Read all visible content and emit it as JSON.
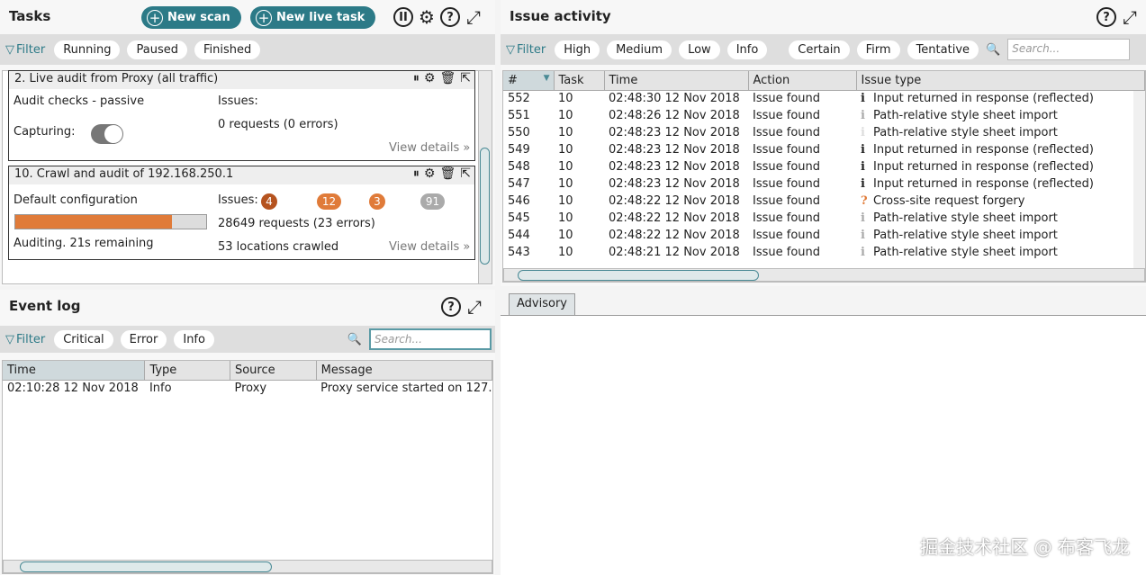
{
  "tasks": {
    "title": "Tasks",
    "new_scan": "New scan",
    "new_live_task": "New live task",
    "filter_label": "Filter",
    "filters": [
      "Running",
      "Paused",
      "Finished"
    ],
    "cards": [
      {
        "title": "2. Live audit from Proxy (all traffic)",
        "config": "Audit checks - passive",
        "issues_label": "Issues:",
        "requests": "0 requests (0 errors)",
        "capturing_label": "Capturing:",
        "capturing_on": true,
        "view_details": "View details"
      },
      {
        "title": "10. Crawl and audit of 192.168.250.1",
        "config": "Default configuration",
        "issues_label": "Issues:",
        "badges": [
          "4",
          "12",
          "3",
          "91"
        ],
        "progress_percent": 82,
        "requests": "28649 requests (23 errors)",
        "status": "Auditing. 21s remaining",
        "locations": "53 locations crawled",
        "view_details": "View details"
      }
    ]
  },
  "event_log": {
    "title": "Event log",
    "filter_label": "Filter",
    "filters": [
      "Critical",
      "Error",
      "Info"
    ],
    "search_placeholder": "Search...",
    "columns": [
      "Time",
      "Type",
      "Source",
      "Message"
    ],
    "rows": [
      [
        "02:10:28 12 Nov 2018",
        "Info",
        "Proxy",
        "Proxy service started on 127."
      ]
    ]
  },
  "issue_activity": {
    "title": "Issue activity",
    "filter_label": "Filter",
    "filters": [
      "High",
      "Medium",
      "Low",
      "Info"
    ],
    "confidence_filters": [
      "Certain",
      "Firm",
      "Tentative"
    ],
    "search_placeholder": "Search...",
    "columns": [
      "#",
      "Task",
      "Time",
      "Action",
      "Issue type"
    ],
    "rows": [
      [
        "552",
        "10",
        "02:48:30 12 Nov 2018",
        "Issue found",
        "Input returned in response (reflected)",
        "i",
        "#222"
      ],
      [
        "551",
        "10",
        "02:48:26 12 Nov 2018",
        "Issue found",
        "Path-relative style sheet import",
        "i",
        "#aaa"
      ],
      [
        "550",
        "10",
        "02:48:23 12 Nov 2018",
        "Issue found",
        "Path-relative style sheet import",
        "i",
        "#ddd"
      ],
      [
        "549",
        "10",
        "02:48:23 12 Nov 2018",
        "Issue found",
        "Input returned in response (reflected)",
        "i",
        "#222"
      ],
      [
        "548",
        "10",
        "02:48:23 12 Nov 2018",
        "Issue found",
        "Input returned in response (reflected)",
        "i",
        "#222"
      ],
      [
        "547",
        "10",
        "02:48:23 12 Nov 2018",
        "Issue found",
        "Input returned in response (reflected)",
        "i",
        "#222"
      ],
      [
        "546",
        "10",
        "02:48:22 12 Nov 2018",
        "Issue found",
        "Cross-site request forgery",
        "?",
        "#e07b39"
      ],
      [
        "545",
        "10",
        "02:48:22 12 Nov 2018",
        "Issue found",
        "Path-relative style sheet import",
        "i",
        "#aaa"
      ],
      [
        "544",
        "10",
        "02:48:22 12 Nov 2018",
        "Issue found",
        "Path-relative style sheet import",
        "i",
        "#aaa"
      ],
      [
        "543",
        "10",
        "02:48:21 12 Nov 2018",
        "Issue found",
        "Path-relative style sheet import",
        "i",
        "#aaa"
      ]
    ]
  },
  "advisory": {
    "tab": "Advisory"
  },
  "watermark": "掘金技术社区 @ 布客飞龙"
}
